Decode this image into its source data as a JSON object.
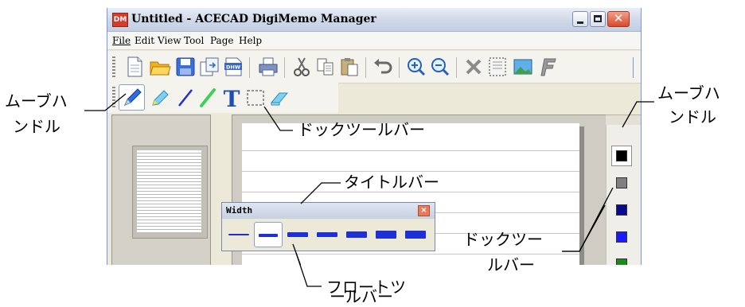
{
  "window": {
    "title": "Untitled - ACECAD DigiMemo Manager",
    "app_icon_text": "DM"
  },
  "menu": [
    "File",
    "Edit",
    "View",
    "Tool",
    "Page",
    "Help"
  ],
  "main_toolbar_icons": [
    "new-page-icon",
    "open-folder-icon",
    "save-icon",
    "export-icon",
    "dhw-icon",
    "print-icon",
    "cut-icon",
    "copy-icon",
    "paste-icon",
    "undo-icon",
    "zoom-in-icon",
    "zoom-out-icon",
    "delete-icon",
    "select-page-icon",
    "image-icon",
    "text-format-icon"
  ],
  "dhw_label": "DHW",
  "dock_toolbar_icons": [
    "pen-icon",
    "highlighter-icon",
    "line-icon",
    "green-line-icon",
    "text-icon",
    "selection-icon",
    "eraser-icon"
  ],
  "text_tool_glyph": "T",
  "float_toolbar": {
    "title": "Width",
    "close_glyph": "×",
    "selected_index": 1,
    "width_levels": [
      1,
      2,
      3,
      4,
      5,
      6,
      7
    ]
  },
  "color_palette": [
    "#000000",
    "#808080",
    "#0a0a8c",
    "#1a1aff",
    "#1a8c1a"
  ],
  "annotations": {
    "move_handle_left_1": "ムーブハ",
    "move_handle_left_2": "ンドル",
    "dock_toolbar_top": "ドックツールバー",
    "title_bar": "タイトルバー",
    "move_handle_right_1": "ムーブハ",
    "move_handle_right_2": "ンドル",
    "dock_toolbar_right_1": "ドックツー",
    "dock_toolbar_right_2": "ルバー",
    "float_toolbar_1": "フロートツ",
    "float_toolbar_2": "ールバー"
  }
}
